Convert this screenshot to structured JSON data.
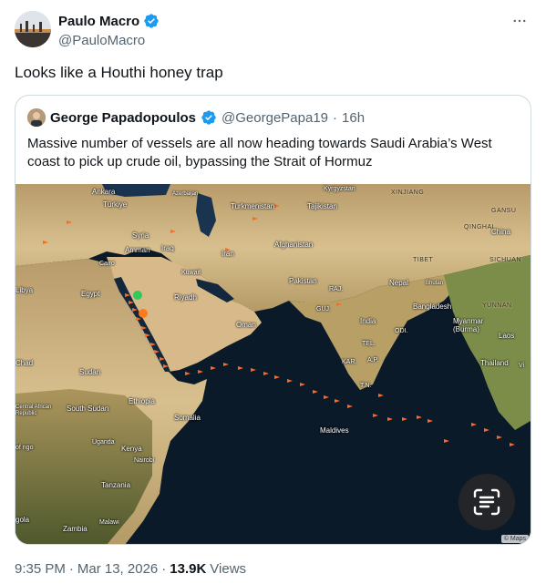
{
  "tweet": {
    "author": {
      "display_name": "Paulo Macro",
      "handle": "@PauloMacro",
      "verified": true
    },
    "text": "Looks like a Houthi honey trap",
    "more_icon": "ellipsis-icon",
    "meta": {
      "time": "9:35 PM",
      "date": "Mar 13, 2026",
      "views_count": "13.9K",
      "views_label": "Views",
      "separator": "·"
    }
  },
  "quote": {
    "author": {
      "display_name": "George Papadopoulos",
      "handle": "@GeorgePapa19",
      "time": "16h",
      "separator": "·",
      "verified": true
    },
    "text": "Massive number of vessels are all now heading towards Saudi Arabia’s West coast to pick up crude oil, bypassing the Strait of Hormuz"
  },
  "map": {
    "labels": {
      "ankara": "Ankara",
      "turkiye": "Türkiye",
      "azerbaijan": "Azerbaijan",
      "turkmenistan": "Turkmenistan",
      "kyrgyzstan": "Kyrgyzstan",
      "tajikistan": "Tajikistan",
      "xinjiang": "XINJIANG",
      "gansu": "GANSU",
      "qinghai": "QINGHAI",
      "china": "China",
      "syria": "Syria",
      "amman": "Amman",
      "iraq": "Iraq",
      "iran": "Iran",
      "afghanistan": "Afghanistan",
      "cairo": "Cairo",
      "kuwait": "Kuwait",
      "tibet": "TIBET",
      "sichuan": "SICHUAN",
      "libya": "Libya",
      "egypt": "Egypt",
      "riyadh": "Riyadh",
      "pakistan": "Pakistan",
      "raj": "RAJ.",
      "nepal": "Nepal",
      "bhutan": "Bhutan",
      "yunnan": "YUNNAN",
      "guj": "GUJ.",
      "india": "India",
      "bangladesh": "Bangladesh",
      "myanmar": "Myanmar (Burma)",
      "oman": "Oman",
      "odi": "ODI.",
      "laos": "Laos",
      "chad": "Chad",
      "sudan": "Sudan",
      "tel": "TEL.",
      "kar": "KAR.",
      "ap": "A.P.",
      "thailand": "Thailand",
      "tn": "T.N.",
      "car": "Central African Republic",
      "south_sudan": "South Sudan",
      "ethiopia": "Ethiopia",
      "somalia": "Somalia",
      "maldives": "Maldives",
      "drc": "of ngo",
      "uganda": "Uganda",
      "kenya": "Kenya",
      "nairobi": "Nairobi",
      "tanzania": "Tanzania",
      "angola": "gola",
      "zambia": "Zambia",
      "malawi": "Malawi",
      "vi": "Vi"
    },
    "attribution": "© Maps",
    "lens_icon": "text-scan-icon"
  }
}
